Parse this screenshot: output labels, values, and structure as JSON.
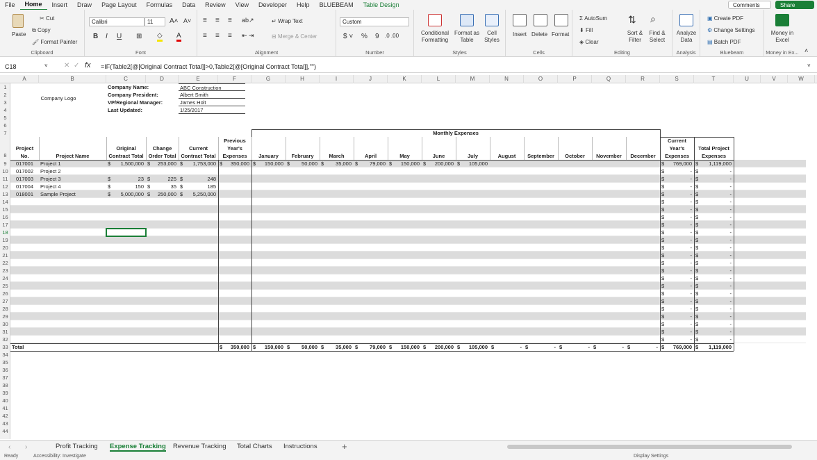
{
  "menu": {
    "tabs": [
      "File",
      "Home",
      "Insert",
      "Draw",
      "Page Layout",
      "Formulas",
      "Data",
      "Review",
      "View",
      "Developer",
      "Help",
      "BLUEBEAM",
      "Table Design"
    ],
    "comments": "Comments",
    "share": "Share"
  },
  "ribbon": {
    "paste": "Paste",
    "cut": "Cut",
    "copy": "Copy",
    "format_painter": "Format Painter",
    "clipboard": "Clipboard",
    "font_name": "Calibri",
    "font_size": "11",
    "font": "Font",
    "wrap_text": "Wrap Text",
    "merge_center": "Merge & Center",
    "alignment": "Alignment",
    "number_format": "Custom",
    "number": "Number",
    "conditional_formatting": "Conditional Formatting",
    "format_as_table": "Format as Table",
    "cell_styles": "Cell Styles",
    "styles": "Styles",
    "insert": "Insert",
    "delete": "Delete",
    "format": "Format",
    "cells": "Cells",
    "autosum": "AutoSum",
    "fill": "Fill",
    "clear": "Clear",
    "sort_filter": "Sort & Filter",
    "find_select": "Find & Select",
    "editing": "Editing",
    "analyze_data": "Analyze Data",
    "analysis": "Analysis",
    "create_pdf": "Create PDF",
    "change_settings": "Change Settings",
    "batch_pdf": "Batch PDF",
    "bluebeam": "Bluebeam",
    "money_in_excel": "Money in Excel",
    "money_group": "Money in Ex..."
  },
  "formula_bar": {
    "name_box": "C18",
    "formula": "=IF(Table2[@[Original Contract Total]]>0,Table2[@[Original Contract Total]],\"\")"
  },
  "columns": [
    "A",
    "B",
    "C",
    "D",
    "E",
    "F",
    "G",
    "H",
    "I",
    "J",
    "K",
    "L",
    "M",
    "N",
    "O",
    "P",
    "Q",
    "R",
    "S",
    "T",
    "U",
    "V",
    "W"
  ],
  "info": {
    "logo": "Company Logo",
    "labels": [
      "Company Name:",
      "Company President:",
      "VP/Regional Manager:",
      "Last Updated:"
    ],
    "values": [
      "ABC Construction",
      "Albert Smith",
      "James Holt",
      "1/25/2017"
    ]
  },
  "monthly_expenses": "Monthly Expenses",
  "headers": [
    "Project No.",
    "Project Name",
    "Original Contract Total",
    "Change Order Total",
    "Current Contract Total",
    "Previous Year's Expenses",
    "January",
    "February",
    "March",
    "April",
    "May",
    "June",
    "July",
    "August",
    "September",
    "October",
    "November",
    "December",
    "Current Year's Expenses",
    "Total Project Expenses"
  ],
  "projects": [
    {
      "no": "017001",
      "name": "Project 1",
      "orig": "1,500,000",
      "change": "253,000",
      "curr": "1,753,000",
      "prev": "350,000",
      "months": [
        "150,000",
        "50,000",
        "35,000",
        "79,000",
        "150,000",
        "200,000",
        "105,000",
        "",
        "",
        "",
        "",
        ""
      ],
      "cye": "769,000",
      "tpe": "1,119,000"
    },
    {
      "no": "017002",
      "name": "Project 2",
      "orig": "",
      "change": "",
      "curr": "",
      "prev": "",
      "months": [
        "",
        "",
        "",
        "",
        "",
        "",
        "",
        "",
        "",
        "",
        "",
        ""
      ],
      "cye": "-",
      "tpe": "-"
    },
    {
      "no": "017003",
      "name": "Project 3",
      "orig": "23",
      "change": "225",
      "curr": "248",
      "prev": "",
      "months": [
        "",
        "",
        "",
        "",
        "",
        "",
        "",
        "",
        "",
        "",
        "",
        ""
      ],
      "cye": "-",
      "tpe": "-"
    },
    {
      "no": "017004",
      "name": "Project 4",
      "orig": "150",
      "change": "35",
      "curr": "185",
      "prev": "",
      "months": [
        "",
        "",
        "",
        "",
        "",
        "",
        "",
        "",
        "",
        "",
        "",
        ""
      ],
      "cye": "-",
      "tpe": "-"
    },
    {
      "no": "018001",
      "name": "Sample Project",
      "orig": "5,000,000",
      "change": "250,000",
      "curr": "5,250,000",
      "prev": "",
      "months": [
        "",
        "",
        "",
        "",
        "",
        "",
        "",
        "",
        "",
        "",
        "",
        ""
      ],
      "cye": "-",
      "tpe": "-"
    }
  ],
  "totals": {
    "label": "Total",
    "prev": "350,000",
    "months": [
      "150,000",
      "50,000",
      "35,000",
      "79,000",
      "150,000",
      "200,000",
      "105,000",
      "-",
      "-",
      "-",
      "-",
      "-"
    ],
    "cye": "769,000",
    "tpe": "1,119,000"
  },
  "empty_dash": "-",
  "currency": "$",
  "sheet_tabs": [
    "Profit Tracking",
    "Expense Tracking",
    "Revenue Tracking",
    "Total Charts",
    "Instructions"
  ],
  "active_sheet": "Expense Tracking",
  "status": {
    "ready": "Ready",
    "accessibility": "Accessibility: Investigate",
    "display": "Display Settings"
  },
  "colors": {
    "accent": "#1a7f37",
    "band": "#dcdcdc"
  }
}
